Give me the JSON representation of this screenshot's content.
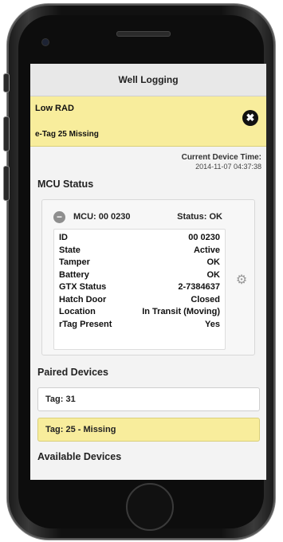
{
  "header": {
    "title": "Well Logging"
  },
  "alert": {
    "line1": "Low RAD",
    "line2": "e-Tag 25 Missing"
  },
  "device_time": {
    "label": "Current Device Time:",
    "value": "2014-11-07 04:37:38"
  },
  "mcu_section": {
    "title": "MCU Status"
  },
  "mcu": {
    "title": "MCU: 00 0230",
    "status": "Status: OK",
    "rows": [
      {
        "key": "ID",
        "value": "00 0230"
      },
      {
        "key": "State",
        "value": "Active"
      },
      {
        "key": "Tamper",
        "value": "OK"
      },
      {
        "key": "Battery",
        "value": "OK"
      },
      {
        "key": "GTX Status",
        "value": "2-7384637"
      },
      {
        "key": "Hatch Door",
        "value": "Closed"
      },
      {
        "key": "Location",
        "value": "In Transit (Moving)"
      },
      {
        "key": "rTag Present",
        "value": "Yes"
      }
    ]
  },
  "paired": {
    "title": "Paired Devices",
    "items": [
      {
        "label": "Tag: 31"
      },
      {
        "label": "Tag: 25 - Missing"
      }
    ]
  },
  "available": {
    "title": "Available Devices"
  },
  "colors": {
    "alert_bg": "#f8ed9c",
    "screen_bg": "#f3f3f3"
  }
}
